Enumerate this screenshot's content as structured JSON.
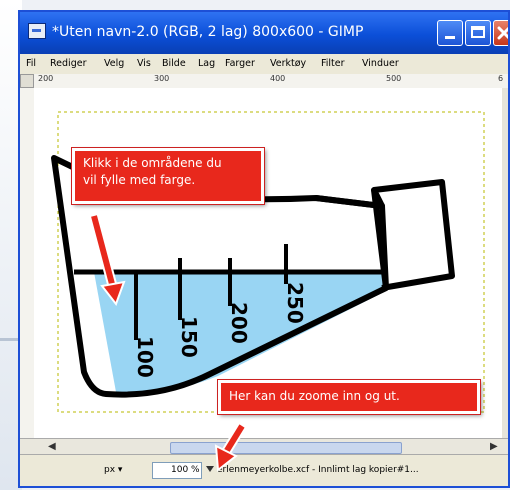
{
  "window": {
    "title": "*Uten navn-2.0 (RGB, 2 lag) 800x600 - GIMP"
  },
  "menubar": {
    "items": [
      "Fil",
      "Rediger",
      "Velg",
      "Vis",
      "Bilde",
      "Lag",
      "Farger",
      "Verktøy",
      "Filter",
      "Vinduer"
    ]
  },
  "ruler": {
    "labels": [
      "200",
      "300",
      "400",
      "500",
      "6"
    ]
  },
  "canvas": {
    "scale_labels": [
      "100",
      "150",
      "200",
      "250"
    ],
    "liquid_color": "#99d5f3"
  },
  "callouts": {
    "fill_hint": "Klikk i de områdene du\nvil fylle med farge.",
    "zoom_hint": "Her kan du zoome inn og ut."
  },
  "statusbar": {
    "unit": "px",
    "zoom": "100 %",
    "status": "erlenmeyerkolbe.xcf - Innlimt lag kopier#1..."
  },
  "colors": {
    "titlebar": "#0b4fd8",
    "callout": "#e8281c"
  }
}
